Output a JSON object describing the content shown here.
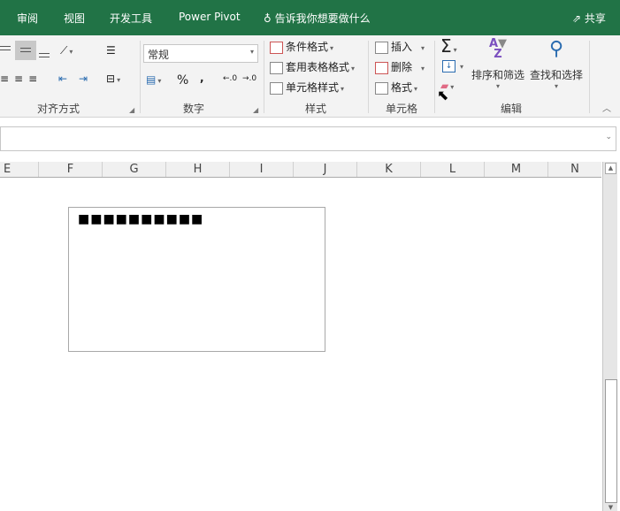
{
  "tabs": [
    "审阅",
    "视图",
    "开发工具",
    "Power Pivot"
  ],
  "tell_me": "告诉我你想要做什么",
  "share": "共享",
  "groups": {
    "alignment": "对齐方式",
    "number": "数字",
    "styles": "样式",
    "cells": "单元格",
    "editing": "编辑"
  },
  "number_format": "常规",
  "number_buttons": {
    "percent": "%",
    "comma": ","
  },
  "styles": {
    "conditional": "条件格式",
    "table": "套用表格格式",
    "cell": "单元格样式"
  },
  "cells": {
    "insert": "插入",
    "delete": "删除",
    "format": "格式"
  },
  "editing": {
    "sort": "排序和筛选",
    "find": "查找和选择"
  },
  "columns": [
    "E",
    "F",
    "G",
    "H",
    "I",
    "J",
    "K",
    "L",
    "M",
    "N"
  ],
  "textbox_content": "■■■■■■■■■■",
  "accent": "#217346"
}
